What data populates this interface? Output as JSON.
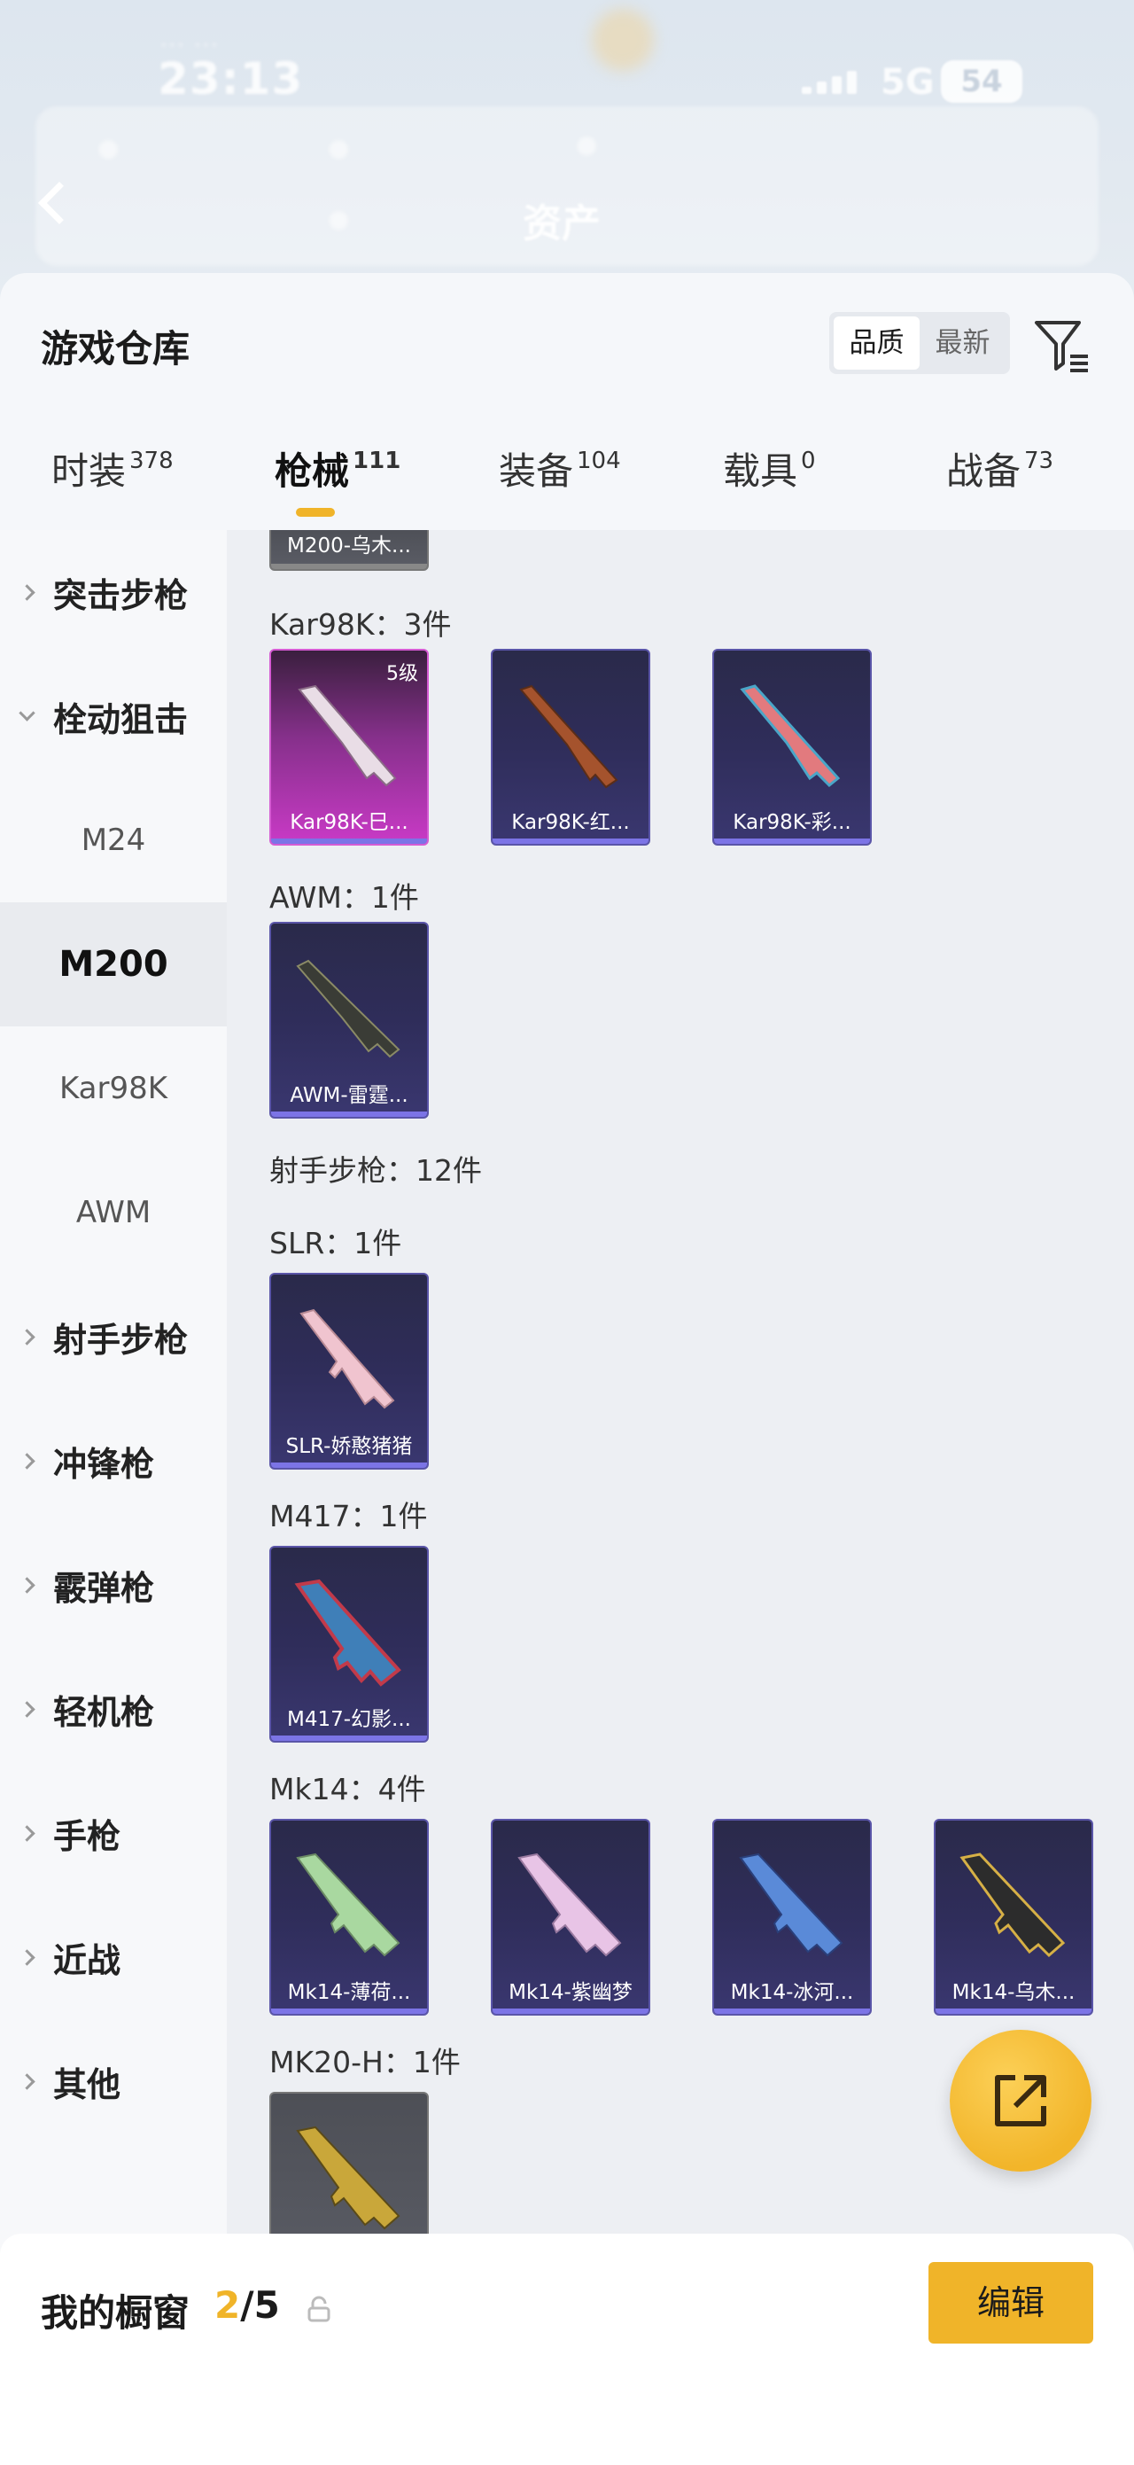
{
  "status_bar": {
    "time": "23:13",
    "network": "5G",
    "battery": "54"
  },
  "header": {
    "title": "资产"
  },
  "sheet": {
    "title": "游戏仓库",
    "sort_options": [
      "品质",
      "最新"
    ],
    "sort_selected": "品质"
  },
  "tabs": [
    {
      "label": "时装",
      "count": "378"
    },
    {
      "label": "枪械",
      "count": "111",
      "active": true
    },
    {
      "label": "装备",
      "count": "104"
    },
    {
      "label": "载具",
      "count": "0"
    },
    {
      "label": "战备",
      "count": "73"
    }
  ],
  "sidenav": {
    "items": [
      {
        "label": "突击步枪"
      },
      {
        "label": "栓动狙击",
        "expanded": true,
        "children": [
          "M24",
          "M200",
          "Kar98K",
          "AWM"
        ],
        "selected_child": "M200"
      },
      {
        "label": "射手步枪"
      },
      {
        "label": "冲锋枪"
      },
      {
        "label": "霰弹枪"
      },
      {
        "label": "轻机枪"
      },
      {
        "label": "手枪"
      },
      {
        "label": "近战"
      },
      {
        "label": "其他"
      }
    ]
  },
  "content": {
    "partial_card": "M200-乌木...",
    "groups": [
      {
        "label": "Kar98K：3件",
        "items": [
          {
            "name": "Kar98K-巳...",
            "level": "5级",
            "rarity": "pink"
          },
          {
            "name": "Kar98K-红...",
            "rarity": "purple"
          },
          {
            "name": "Kar98K-彩...",
            "rarity": "purple"
          }
        ]
      },
      {
        "label": "AWM：1件",
        "items": [
          {
            "name": "AWM-雷霆...",
            "rarity": "purple"
          }
        ]
      },
      {
        "label": "射手步枪：12件",
        "items": []
      },
      {
        "label": "SLR：1件",
        "items": [
          {
            "name": "SLR-娇憨猪猪",
            "rarity": "purple"
          }
        ]
      },
      {
        "label": "M417：1件",
        "items": [
          {
            "name": "M417-幻影...",
            "rarity": "purple"
          }
        ]
      },
      {
        "label": "Mk14：4件",
        "items": [
          {
            "name": "Mk14-薄荷...",
            "rarity": "purple"
          },
          {
            "name": "Mk14-紫幽梦",
            "rarity": "purple"
          },
          {
            "name": "Mk14-冰河...",
            "rarity": "purple"
          },
          {
            "name": "Mk14-乌木...",
            "rarity": "purple"
          }
        ]
      },
      {
        "label": "MK20-H：1件",
        "items": [
          {
            "name": "",
            "rarity": "gray"
          }
        ]
      }
    ]
  },
  "showcase": {
    "label": "我的橱窗",
    "current": "2",
    "total": "/5",
    "edit_label": "编辑"
  },
  "colors": {
    "accent": "#f0b429",
    "rarity_purple": "#5a55a8",
    "rarity_pink": "#c93ac6"
  }
}
